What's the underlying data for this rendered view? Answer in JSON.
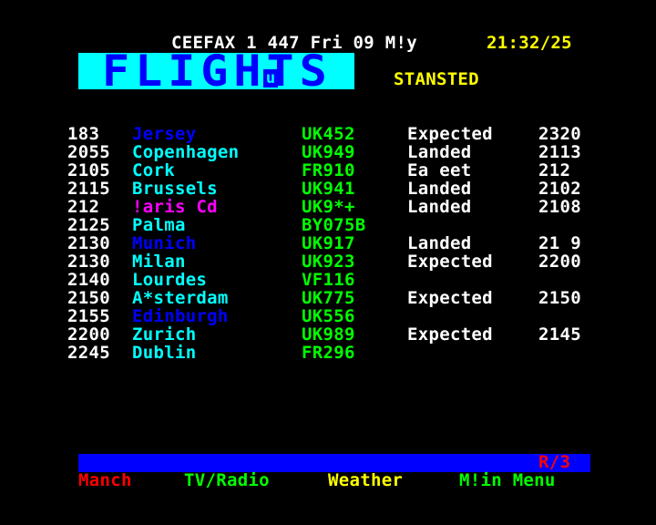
{
  "header": {
    "line": "CEEFAX 1 447 Fri 09 M!y",
    "clock": "21:32/25"
  },
  "banner": {
    "title": "FLIGHTS",
    "sub_glyph": "u",
    "airport": "STANSTED"
  },
  "flights": [
    {
      "time": "183",
      "city": "Jersey",
      "city_color": "#0000ff",
      "flight": "UK452",
      "status": "Expected",
      "status_time": "2320"
    },
    {
      "time": "2055",
      "city": "Copenhagen",
      "city_color": "#00ffff",
      "flight": "UK949",
      "status": "Landed",
      "status_time": "2113"
    },
    {
      "time": "2105",
      "city": "Cork",
      "city_color": "#00ffff",
      "flight": "FR910",
      "status": "Ea eet",
      "status_time": "212"
    },
    {
      "time": "2115",
      "city": "Brussels",
      "city_color": "#00ffff",
      "flight": "UK941",
      "status": "Landed",
      "status_time": "2102"
    },
    {
      "time": "212",
      "city": "!aris Cd",
      "city_color": "#ff00ff",
      "flight": "UK9*+",
      "status": "Landed",
      "status_time": "2108"
    },
    {
      "time": "2125",
      "city": "Palma",
      "city_color": "#00ffff",
      "flight": "BY075B",
      "status": "",
      "status_time": ""
    },
    {
      "time": "2130",
      "city": "Munich",
      "city_color": "#0000ff",
      "flight": "UK917",
      "status": "Landed",
      "status_time": "21 9"
    },
    {
      "time": "2130",
      "city": "Milan",
      "city_color": "#00ffff",
      "flight": "UK923",
      "status": "Expected",
      "status_time": "2200"
    },
    {
      "time": "2140",
      "city": "Lourdes",
      "city_color": "#00ffff",
      "flight": "VF116",
      "status": "",
      "status_time": ""
    },
    {
      "time": "2150",
      "city": "A*sterdam",
      "city_color": "#00ffff",
      "flight": "UK775",
      "status": "Expected",
      "status_time": "2150"
    },
    {
      "time": "2155",
      "city": "Edinburgh",
      "city_color": "#0000ff",
      "flight": "UK556",
      "status": "",
      "status_time": ""
    },
    {
      "time": "2200",
      "city": "Zurich",
      "city_color": "#00ffff",
      "flight": "UK989",
      "status": "Expected",
      "status_time": "2145"
    },
    {
      "time": "2245",
      "city": "Dublin",
      "city_color": "#00ffff",
      "flight": "FR296",
      "status": "",
      "status_time": ""
    }
  ],
  "footer": {
    "page_indicator": "R/3",
    "fastext": [
      {
        "label": "Manch",
        "color": "#ff0000"
      },
      {
        "label": "TV/Radio",
        "color": "#00ff00"
      },
      {
        "label": "Weather",
        "color": "#ffff00"
      },
      {
        "label": "M!in Menu",
        "color": "#00ff00"
      }
    ]
  }
}
